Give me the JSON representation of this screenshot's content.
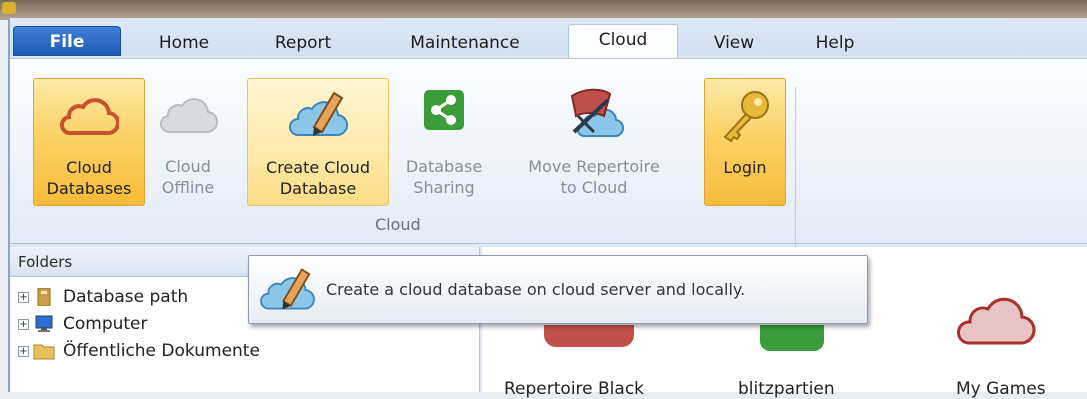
{
  "ribbon_tabs": [
    {
      "label": "File"
    },
    {
      "label": "Home"
    },
    {
      "label": "Report"
    },
    {
      "label": "Maintenance"
    },
    {
      "label": "Cloud",
      "active": true
    },
    {
      "label": "View"
    },
    {
      "label": "Help"
    }
  ],
  "ribbon": {
    "cloud_databases": {
      "line1": "Cloud",
      "line2": "Databases",
      "icon": "cloud-icon"
    },
    "cloud_offline": {
      "line1": "Cloud",
      "line2": "Offline",
      "icon": "cloud-offline-icon"
    },
    "create_cloud_database": {
      "line1": "Create Cloud",
      "line2": "Database",
      "icon": "cloud-pencil-icon"
    },
    "database_sharing": {
      "line1": "Database",
      "line2": "Sharing",
      "icon": "share-icon"
    },
    "move_repertoire": {
      "line1": "Move Repertoire",
      "line2": "to Cloud",
      "icon": "repertoire-cloud-icon"
    },
    "login": {
      "line1": "Login",
      "icon": "key-icon"
    },
    "group_label": "Cloud"
  },
  "folders": {
    "header": "Folders",
    "items": [
      {
        "label": "Database path",
        "icon": "database-folder-icon"
      },
      {
        "label": "Computer",
        "icon": "computer-icon"
      },
      {
        "label": "Öffentliche Dokumente",
        "icon": "folder-icon"
      }
    ]
  },
  "databases": [
    {
      "label": "Repertoire Black"
    },
    {
      "label": "blitzpartien"
    },
    {
      "label": "My Games"
    }
  ],
  "tooltip": {
    "text": "Create a cloud database on cloud server and locally.",
    "icon": "cloud-pencil-icon"
  },
  "colors": {
    "file_tab": "#2a66c0",
    "active_button": "#fbd264",
    "cloud_orange": "#c9512c",
    "cloud_blue": "#6fb3dc",
    "share_green": "#3a9d3a"
  }
}
